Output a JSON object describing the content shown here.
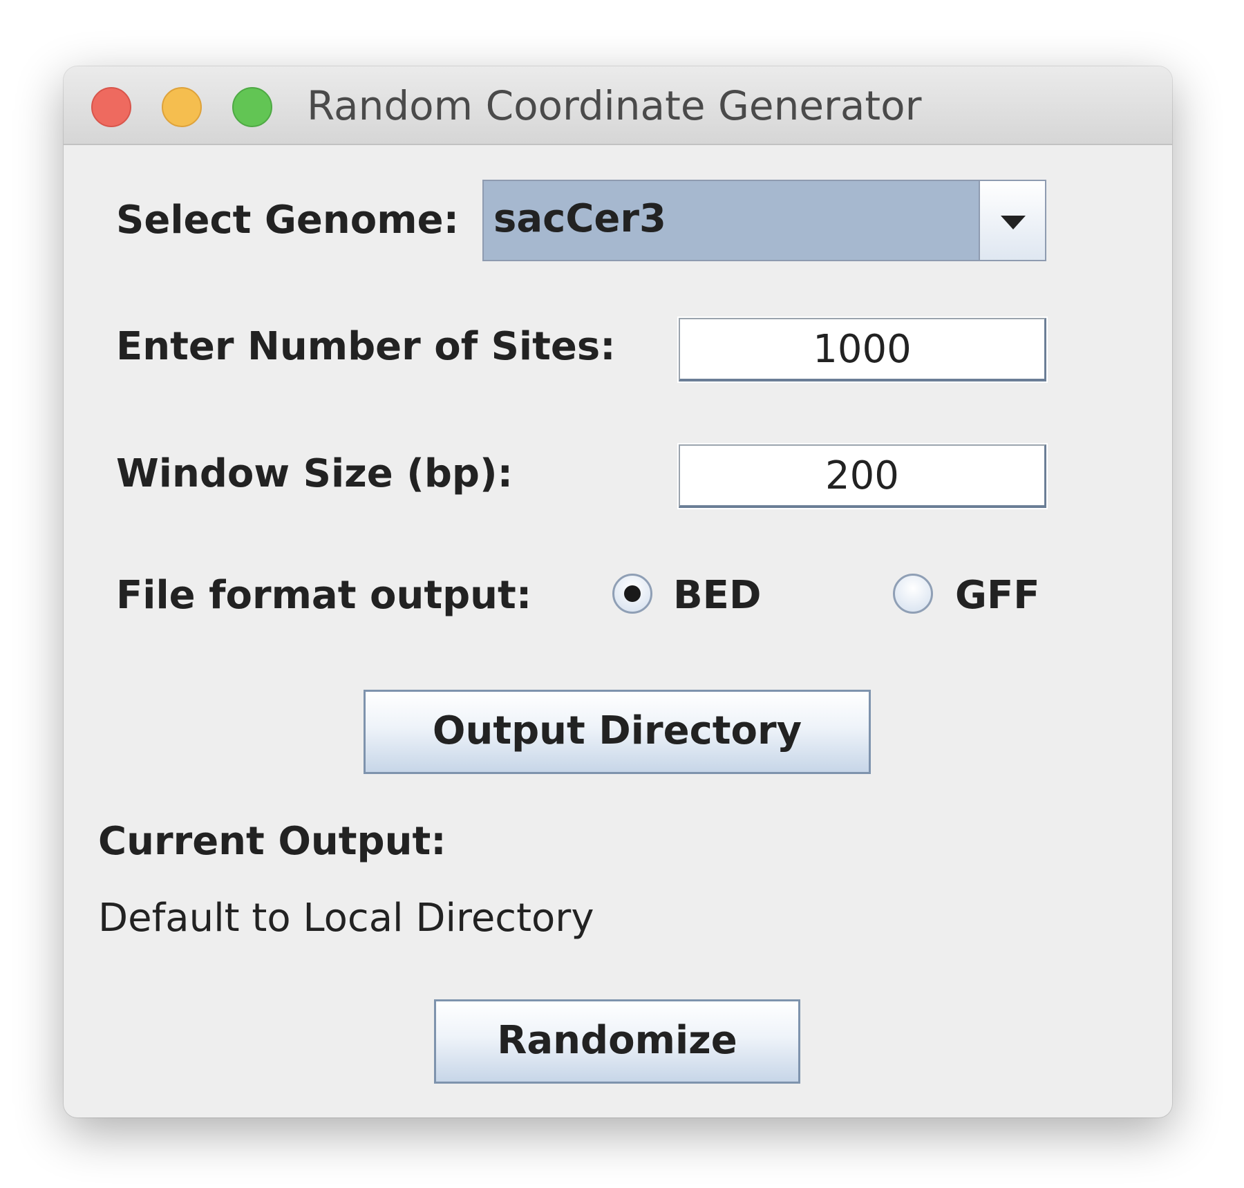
{
  "window": {
    "title": "Random Coordinate Generator"
  },
  "genome": {
    "label": "Select Genome:",
    "selected": "sacCer3"
  },
  "sites": {
    "label": "Enter Number of Sites:",
    "value": "1000"
  },
  "window_size": {
    "label": "Window Size (bp):",
    "value": "200"
  },
  "file_format": {
    "label": "File format output:",
    "options": [
      {
        "label": "BED",
        "selected": true
      },
      {
        "label": "GFF",
        "selected": false
      }
    ]
  },
  "output": {
    "button_label": "Output Directory",
    "current_label": "Current Output:",
    "current_value": "Default to Local Directory"
  },
  "actions": {
    "randomize_label": "Randomize"
  },
  "colors": {
    "window_bg": "#eeeeee",
    "combo_selected_bg": "#a6b8cf",
    "close": "#ee6a5f",
    "minimize": "#f5be4f",
    "maximize": "#62c554"
  },
  "icons": {
    "combo_arrow": "chevron-down-icon"
  }
}
